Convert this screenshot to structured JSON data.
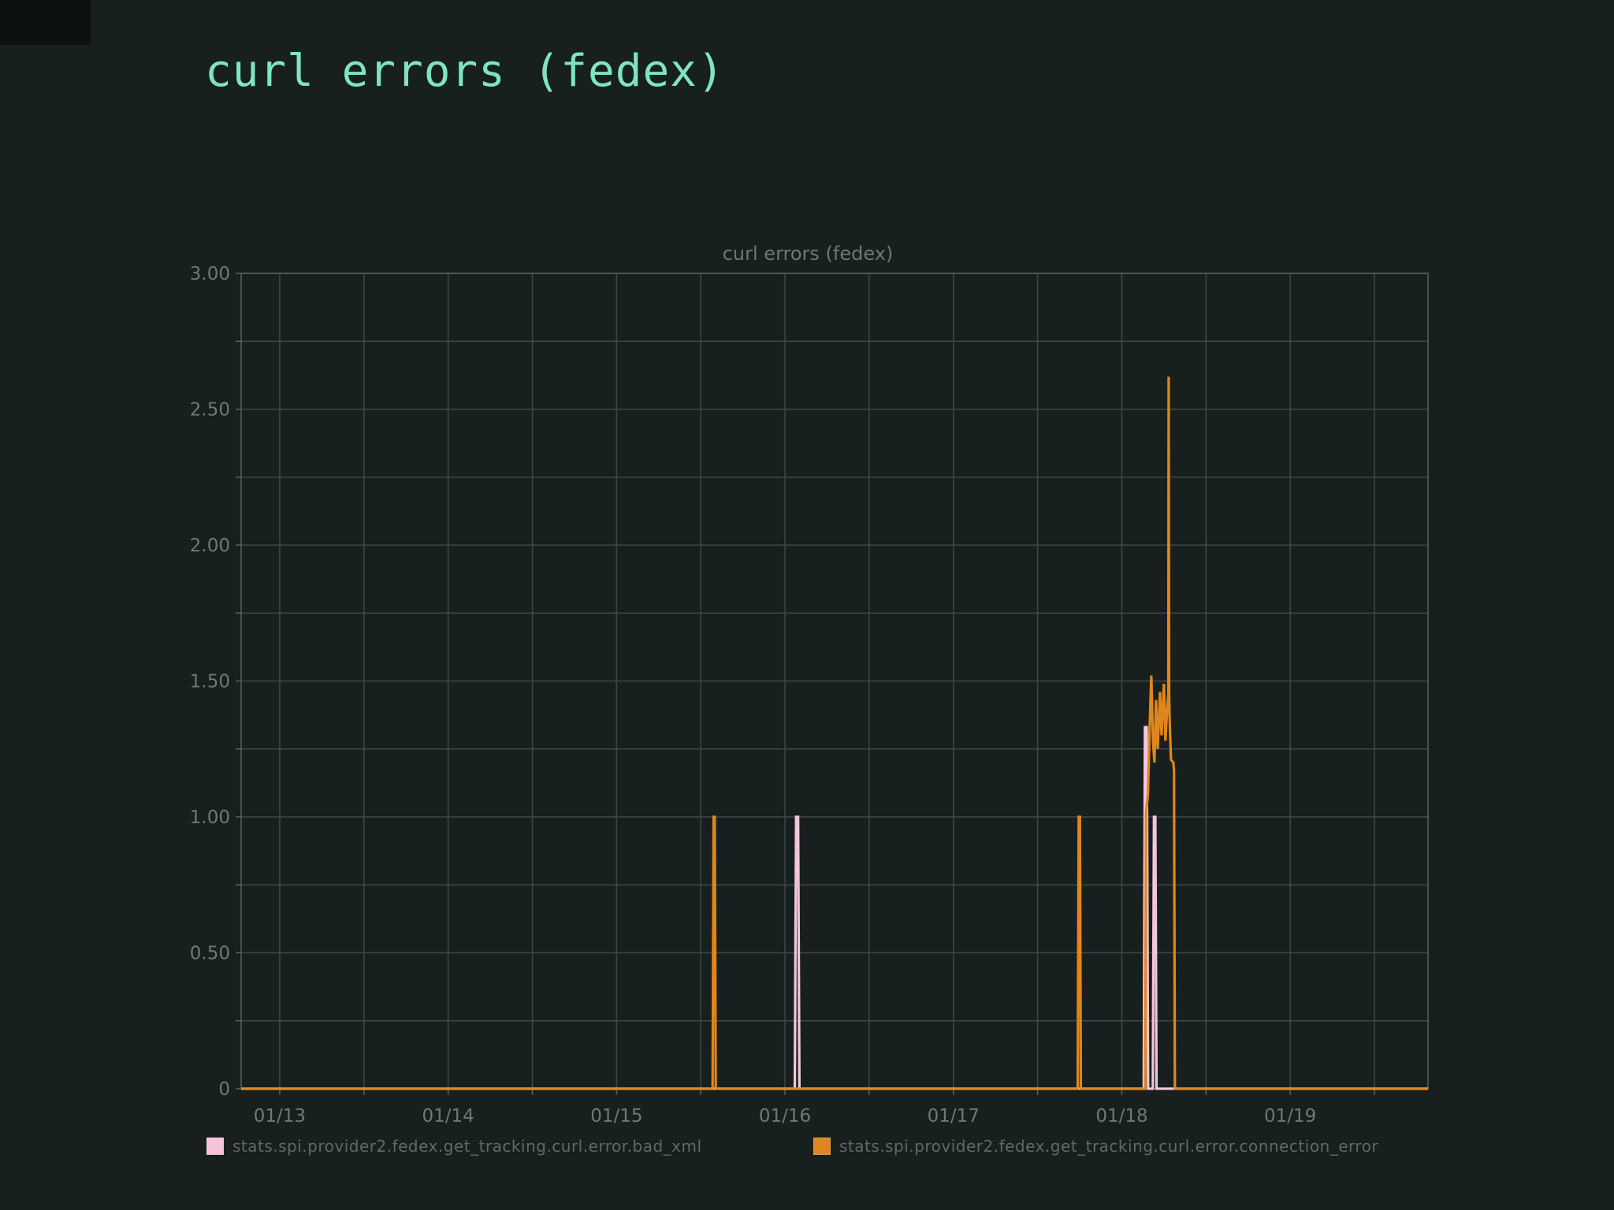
{
  "page": {
    "title": "curl errors (fedex)",
    "title_color": "#80e3c3",
    "background_color": "#17201e"
  },
  "chart": {
    "title": "curl errors (fedex)",
    "legend": [
      {
        "label": "stats.spi.provider2.fedex.get_tracking.curl.error.bad_xml",
        "color": "#f6c3d9"
      },
      {
        "label": "stats.spi.provider2.fedex.get_tracking.curl.error.connection_error",
        "color": "#e0861f"
      }
    ]
  },
  "chart_data": {
    "type": "line",
    "title": "curl errors (fedex)",
    "x_unit": "days since 01/13 00:00",
    "xlim": [
      -0.229,
      6.818
    ],
    "ylim": [
      0,
      3
    ],
    "y_gridline_step": 0.25,
    "y_ticks": [
      {
        "value": 0,
        "label": "0"
      },
      {
        "value": 0.5,
        "label": "0.50"
      },
      {
        "value": 1.0,
        "label": "1.00"
      },
      {
        "value": 1.5,
        "label": "1.50"
      },
      {
        "value": 2.0,
        "label": "2.00"
      },
      {
        "value": 2.5,
        "label": "2.50"
      },
      {
        "value": 3.0,
        "label": "3.00"
      }
    ],
    "x_gridline_step_days": 0.5,
    "x_ticks": [
      {
        "day": 0,
        "label": "01/13"
      },
      {
        "day": 1,
        "label": "01/14"
      },
      {
        "day": 2,
        "label": "01/15"
      },
      {
        "day": 3,
        "label": "01/16"
      },
      {
        "day": 4,
        "label": "01/17"
      },
      {
        "day": 5,
        "label": "01/18"
      },
      {
        "day": 6,
        "label": "01/19"
      }
    ],
    "grid": true,
    "legend_position": "bottom",
    "colors": {
      "grid": "#3e4947",
      "frame": "#57625f",
      "tick_label": "#6e7976",
      "chart_title": "#6d7875"
    },
    "series": [
      {
        "name": "stats.spi.provider2.fedex.get_tracking.curl.error.bad_xml",
        "color": "#f4c6d9",
        "points": [
          [
            -0.229,
            0
          ],
          [
            3.058,
            0
          ],
          [
            3.066,
            1.0
          ],
          [
            3.078,
            1.0
          ],
          [
            3.086,
            0
          ],
          [
            5.13,
            0
          ],
          [
            5.137,
            1.33
          ],
          [
            5.148,
            1.33
          ],
          [
            5.156,
            0
          ],
          [
            5.184,
            0
          ],
          [
            5.191,
            1.0
          ],
          [
            5.199,
            1.0
          ],
          [
            5.206,
            0
          ],
          [
            6.818,
            0
          ]
        ]
      },
      {
        "name": "stats.spi.provider2.fedex.get_tracking.curl.error.connection_error",
        "color": "#e1861c",
        "points": [
          [
            -0.229,
            0
          ],
          [
            2.57,
            0
          ],
          [
            2.576,
            1.0
          ],
          [
            2.583,
            1.0
          ],
          [
            2.589,
            0
          ],
          [
            4.738,
            0
          ],
          [
            4.744,
            1.0
          ],
          [
            4.751,
            1.0
          ],
          [
            4.757,
            0
          ],
          [
            5.139,
            0
          ],
          [
            5.144,
            1.02
          ],
          [
            5.155,
            1.08
          ],
          [
            5.166,
            1.35
          ],
          [
            5.175,
            1.52
          ],
          [
            5.185,
            1.28
          ],
          [
            5.194,
            1.2
          ],
          [
            5.203,
            1.43
          ],
          [
            5.213,
            1.25
          ],
          [
            5.227,
            1.46
          ],
          [
            5.236,
            1.3
          ],
          [
            5.25,
            1.49
          ],
          [
            5.259,
            1.28
          ],
          [
            5.269,
            1.4
          ],
          [
            5.276,
            1.45
          ],
          [
            5.278,
            2.62
          ],
          [
            5.281,
            1.45
          ],
          [
            5.284,
            1.35
          ],
          [
            5.292,
            1.21
          ],
          [
            5.306,
            1.2
          ],
          [
            5.31,
            1.17
          ],
          [
            5.315,
            0
          ],
          [
            6.818,
            0
          ]
        ]
      }
    ]
  }
}
